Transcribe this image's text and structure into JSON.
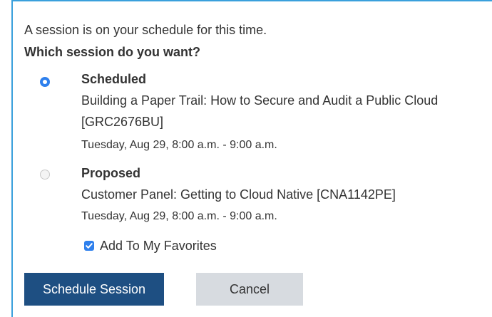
{
  "dialog": {
    "intro_text": "A session is on your schedule for this time.",
    "question": "Which session do you want?",
    "options": [
      {
        "type_label": "Scheduled",
        "title": "Building a Paper Trail: How to Secure and Audit a Public Cloud [GRC2676BU]",
        "time": "Tuesday, Aug 29, 8:00 a.m. - 9:00 a.m.",
        "selected": true
      },
      {
        "type_label": "Proposed",
        "title": "Customer Panel: Getting to Cloud Native [CNA1142PE]",
        "time": "Tuesday, Aug 29, 8:00 a.m. - 9:00 a.m.",
        "selected": false
      }
    ],
    "favorites": {
      "label": "Add To My Favorites",
      "checked": true
    },
    "buttons": {
      "primary_label": "Schedule Session",
      "secondary_label": "Cancel"
    }
  },
  "colors": {
    "accent_border": "#3aa0dc",
    "radio_selected": "#2f80ed",
    "primary_button": "#1e4f82",
    "secondary_button": "#d7dbe0"
  }
}
